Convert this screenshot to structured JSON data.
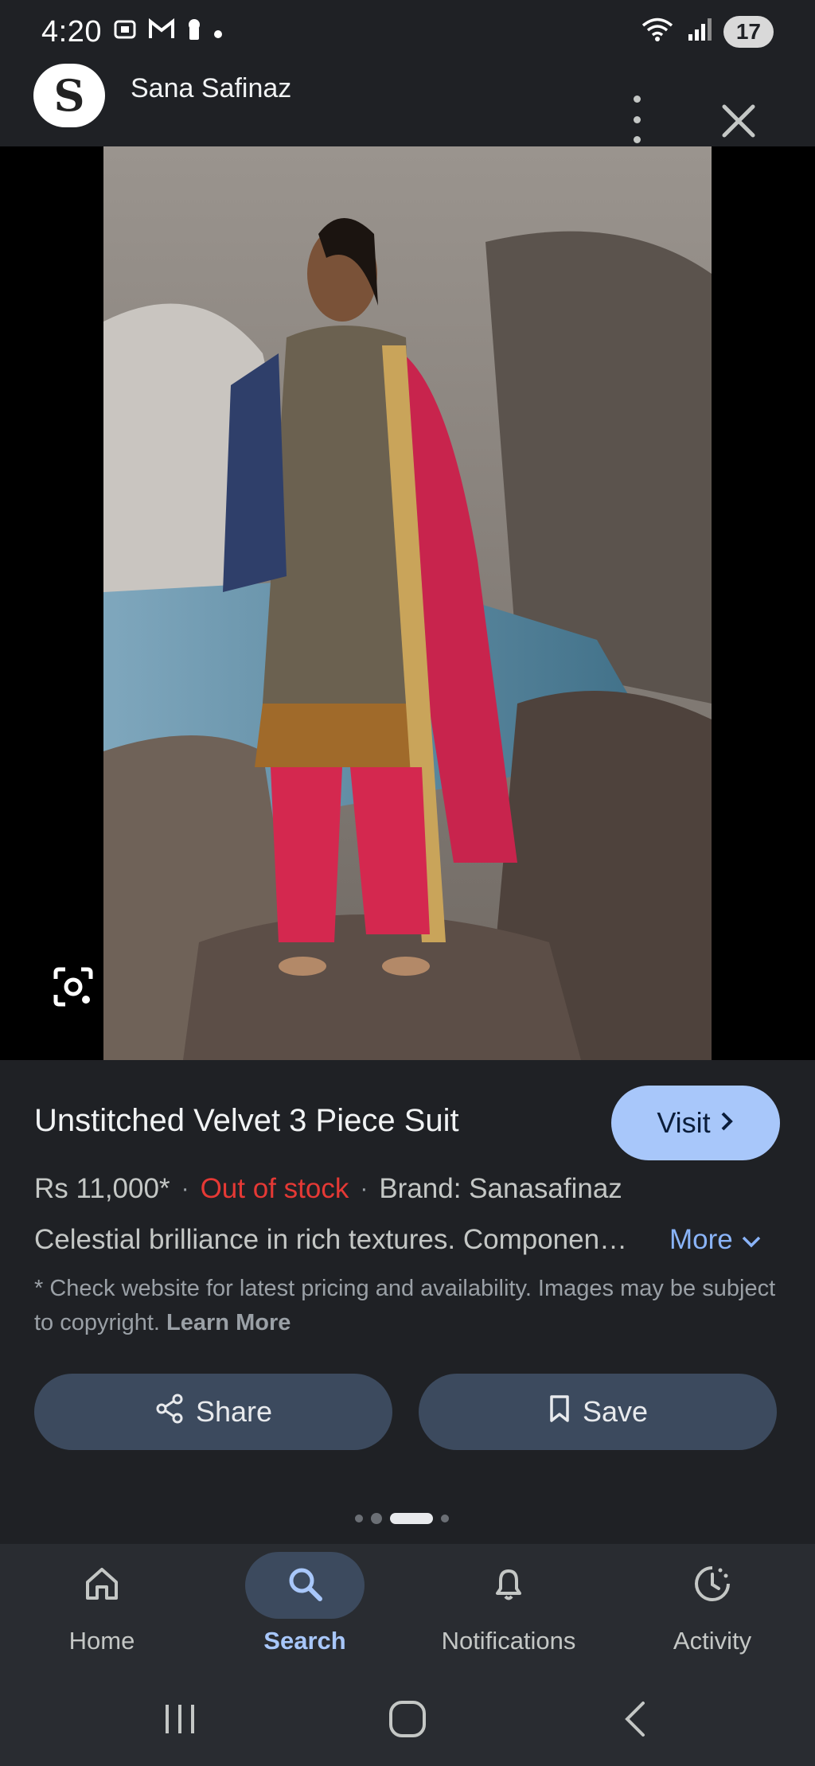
{
  "status_bar": {
    "time": "4:20",
    "battery": "17"
  },
  "source": {
    "logo_letter": "S",
    "name": "Sana Safinaz"
  },
  "product": {
    "title": "Unstitched Velvet 3 Piece Suit",
    "price": "Rs 11,000*",
    "stock_status": "Out of stock",
    "brand": "Brand: Sanasafinaz",
    "description": "Celestial brilliance in rich textures. Componen…",
    "more_label": "More",
    "disclaimer": "* Check website for latest pricing and availability. Images may be subject to copyright.",
    "learn_more_label": "Learn More",
    "visit_label": "Visit",
    "share_label": "Share",
    "save_label": "Save"
  },
  "pager": {
    "count": 4,
    "active_index": 2
  },
  "bottom_nav": {
    "items": [
      {
        "label": "Home",
        "icon": "home-icon",
        "active": false
      },
      {
        "label": "Search",
        "icon": "search-icon",
        "active": true
      },
      {
        "label": "Notifications",
        "icon": "bell-icon",
        "active": false
      },
      {
        "label": "Activity",
        "icon": "activity-icon",
        "active": false
      }
    ]
  },
  "colors": {
    "background": "#1f2125",
    "accent": "#a8c7fa",
    "link": "#8ab4f8",
    "out_of_stock": "#e53935",
    "button_bg": "#3c4a5e"
  }
}
